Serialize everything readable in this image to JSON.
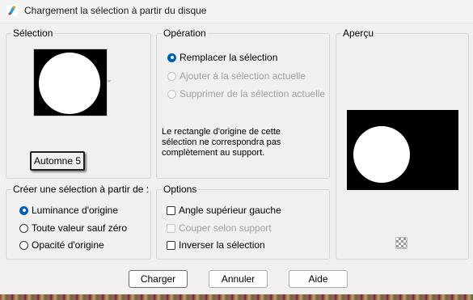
{
  "window": {
    "title": "Chargement la sélection à partir du disque",
    "icon": "paint-brush-app-icon"
  },
  "selection_group": {
    "label": "Sélection",
    "preview_icon": "selection-thumbnail-circle",
    "name_box": "Automne 5"
  },
  "operation_group": {
    "label": "Opération",
    "options": [
      {
        "label": "Remplacer la sélection",
        "checked": true,
        "enabled": true
      },
      {
        "label": "Ajouter à la sélection actuelle",
        "checked": false,
        "enabled": false
      },
      {
        "label": "Supprimer de la sélection actuelle",
        "checked": false,
        "enabled": false
      }
    ],
    "warning": "Le rectangle d'origine de cette sélection ne correspondra pas complètement au support."
  },
  "preview_group": {
    "label": "Aperçu"
  },
  "create_group": {
    "label": "Créer une sélection à partir de :",
    "options": [
      {
        "label": "Luminance d'origine",
        "checked": true
      },
      {
        "label": "Toute valeur sauf zéro",
        "checked": false
      },
      {
        "label": "Opacité d'origine",
        "checked": false
      }
    ]
  },
  "options_group": {
    "label": "Options",
    "checkboxes": [
      {
        "label": "Angle supérieur gauche",
        "checked": false,
        "enabled": true
      },
      {
        "label": "Couper selon support",
        "checked": false,
        "enabled": false
      },
      {
        "label": "Inverser la sélection",
        "checked": false,
        "enabled": true
      }
    ]
  },
  "buttons": {
    "load": "Charger",
    "cancel": "Annuler",
    "help": "Aide"
  },
  "colors": {
    "accent": "#005fb8",
    "disabled_text": "#a0a0a0"
  }
}
